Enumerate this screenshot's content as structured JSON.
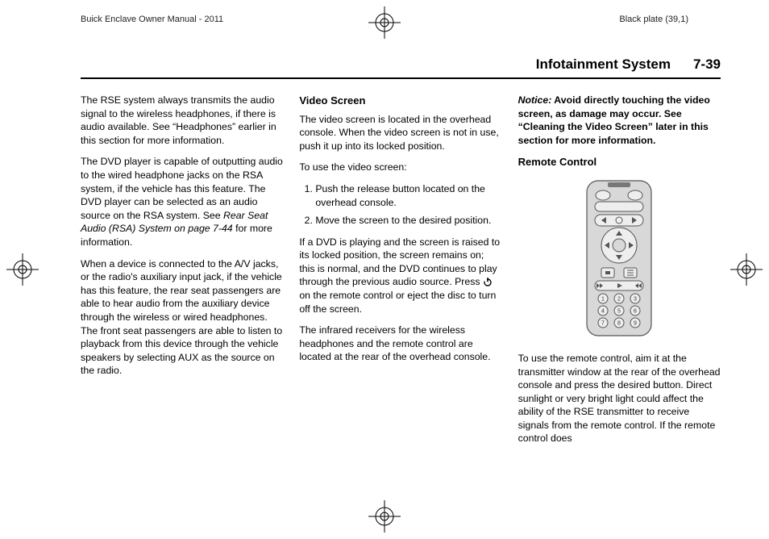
{
  "header": {
    "left": "Buick Enclave Owner Manual - 2011",
    "right": "Black plate (39,1)"
  },
  "running_head": {
    "section": "Infotainment System",
    "page": "7-39"
  },
  "col1": {
    "p1": "The RSE system always transmits the audio signal to the wireless headphones, if there is audio available. See “Headphones” earlier in this section for more information.",
    "p2a": "The DVD player is capable of outputting audio to the wired headphone jacks on the RSA system, if the vehicle has this feature. The DVD player can be selected as an audio source on the RSA system. See ",
    "p2i": "Rear Seat Audio (RSA) System on page 7‑44",
    "p2b": " for more information.",
    "p3": "When a device is connected to the A/V jacks, or the radio's auxiliary input jack, if the vehicle has this feature, the rear seat passengers are able to hear audio from the auxiliary device through the wireless or wired headphones. The front seat passengers are able to listen to playback from this device through the vehicle speakers by selecting AUX as the source on the radio."
  },
  "col2": {
    "h1": "Video Screen",
    "p1": "The video screen is located in the overhead console. When the video screen is not in use, push it up into its locked position.",
    "p2": "To use the video screen:",
    "li1": "Push the release button located on the overhead console.",
    "li2": "Move the screen to the desired position.",
    "p3a": "If a DVD is playing and the screen is raised to its locked position, the screen remains on; this is normal, and the DVD continues to play through the previous audio source. Press ",
    "p3b": " on the remote control or eject the disc to turn off the screen.",
    "p4": "The infrared receivers for the wireless headphones and the remote control are located at the rear of the overhead console."
  },
  "col3": {
    "notice_label": "Notice:",
    "notice_text": " Avoid directly touching the video screen, as damage may occur. See “Cleaning the Video Screen” later in this section for more information.",
    "h1": "Remote Control",
    "p1": "To use the remote control, aim it at the transmitter window at the rear of the overhead console and press the desired button. Direct sunlight or very bright light could affect the ability of the RSE transmitter to receive signals from the remote control. If the remote control does"
  }
}
